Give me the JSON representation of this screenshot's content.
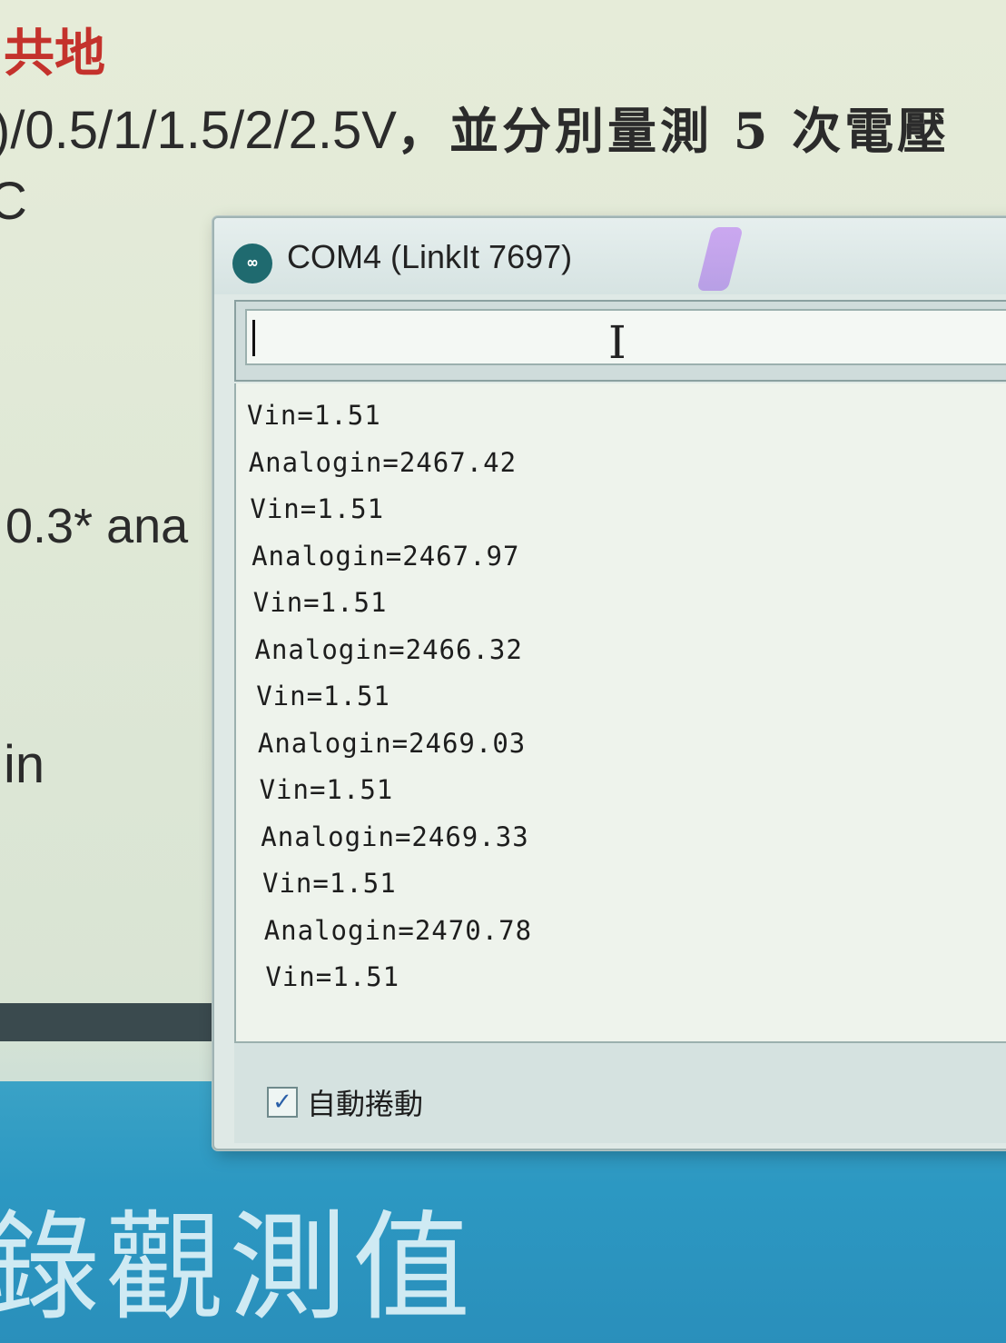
{
  "background": {
    "heading": "共地",
    "line2_numbers": ")/0.5/1/1.5/2/2.5V",
    "line2_cjk": "，並分別量測 5 次電壓",
    "line3": "C",
    "formula": "0.3* ana",
    "in_text": "in",
    "footer": "錄觀測值"
  },
  "window": {
    "icon": "arduino-logo-icon",
    "title": "COM4 (LinkIt 7697)",
    "input": {
      "value": "",
      "placeholder": ""
    },
    "output_lines": [
      "Vin=1.51",
      "Analogin=2467.42",
      "Vin=1.51",
      "Analogin=2467.97",
      "Vin=1.51",
      "Analogin=2466.32",
      "Vin=1.51",
      "Analogin=2469.03",
      "Vin=1.51",
      "Analogin=2469.33",
      "Vin=1.51",
      "Analogin=2470.78",
      "Vin=1.51"
    ],
    "autoscroll": {
      "label": "自動捲動",
      "checked": true,
      "check_glyph": "✓"
    }
  },
  "colors": {
    "heading_red": "#c4322c",
    "footer_blue": "#2c98c2",
    "icon_teal": "#1f6a6f"
  }
}
